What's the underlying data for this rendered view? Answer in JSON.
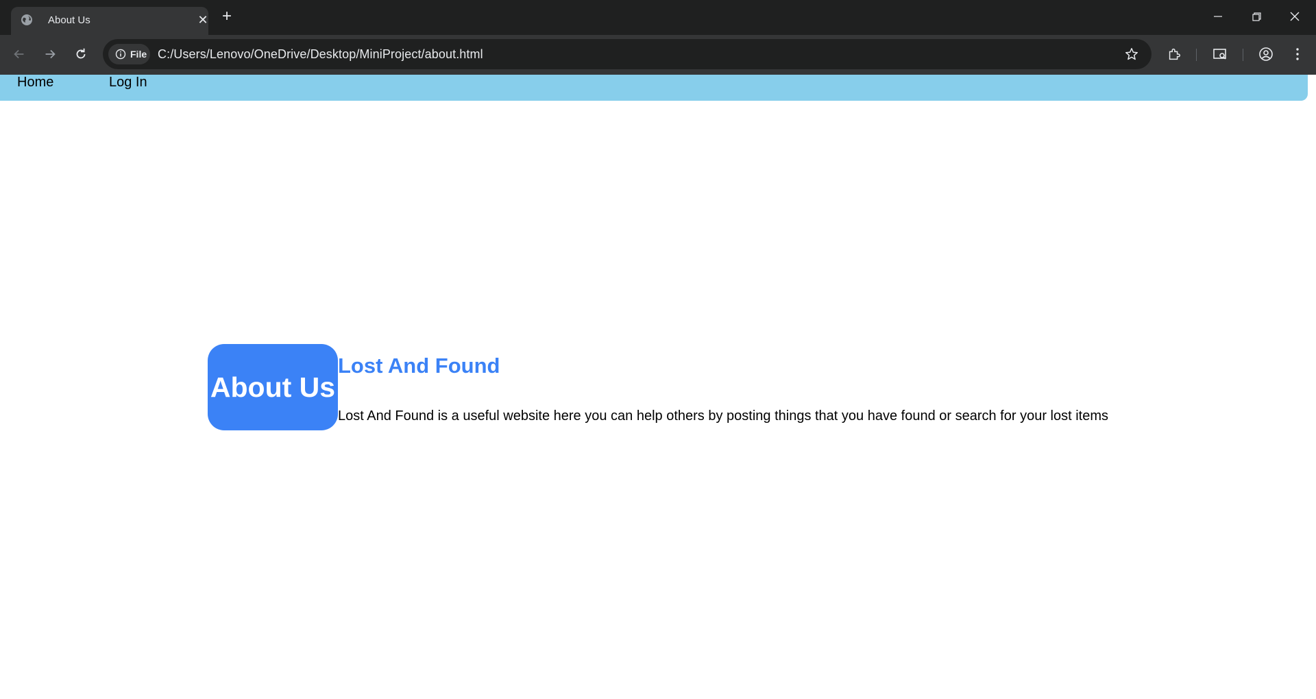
{
  "browser": {
    "tab": {
      "title": "About Us",
      "favicon": "globe-icon"
    },
    "address_bar": {
      "scheme_chip": "File",
      "url": "C:/Users/Lenovo/OneDrive/Desktop/MiniProject/about.html"
    },
    "icons": [
      "back-arrow-icon",
      "forward-arrow-icon",
      "reload-icon",
      "info-icon",
      "star-icon",
      "extensions-icon",
      "tab-search-icon",
      "profile-icon",
      "menu-icon",
      "minimize-icon",
      "restore-icon",
      "close-icon"
    ]
  },
  "page": {
    "nav": {
      "links": [
        {
          "label": "Home"
        },
        {
          "label": "Log In"
        }
      ],
      "background": "#87ceeb"
    },
    "about_box": {
      "title": "About Us",
      "background": "#3b82f6"
    },
    "heading": "Lost And Found",
    "description": "Lost And Found is a useful website here you can help others by posting things that you have found or search for your lost items"
  }
}
